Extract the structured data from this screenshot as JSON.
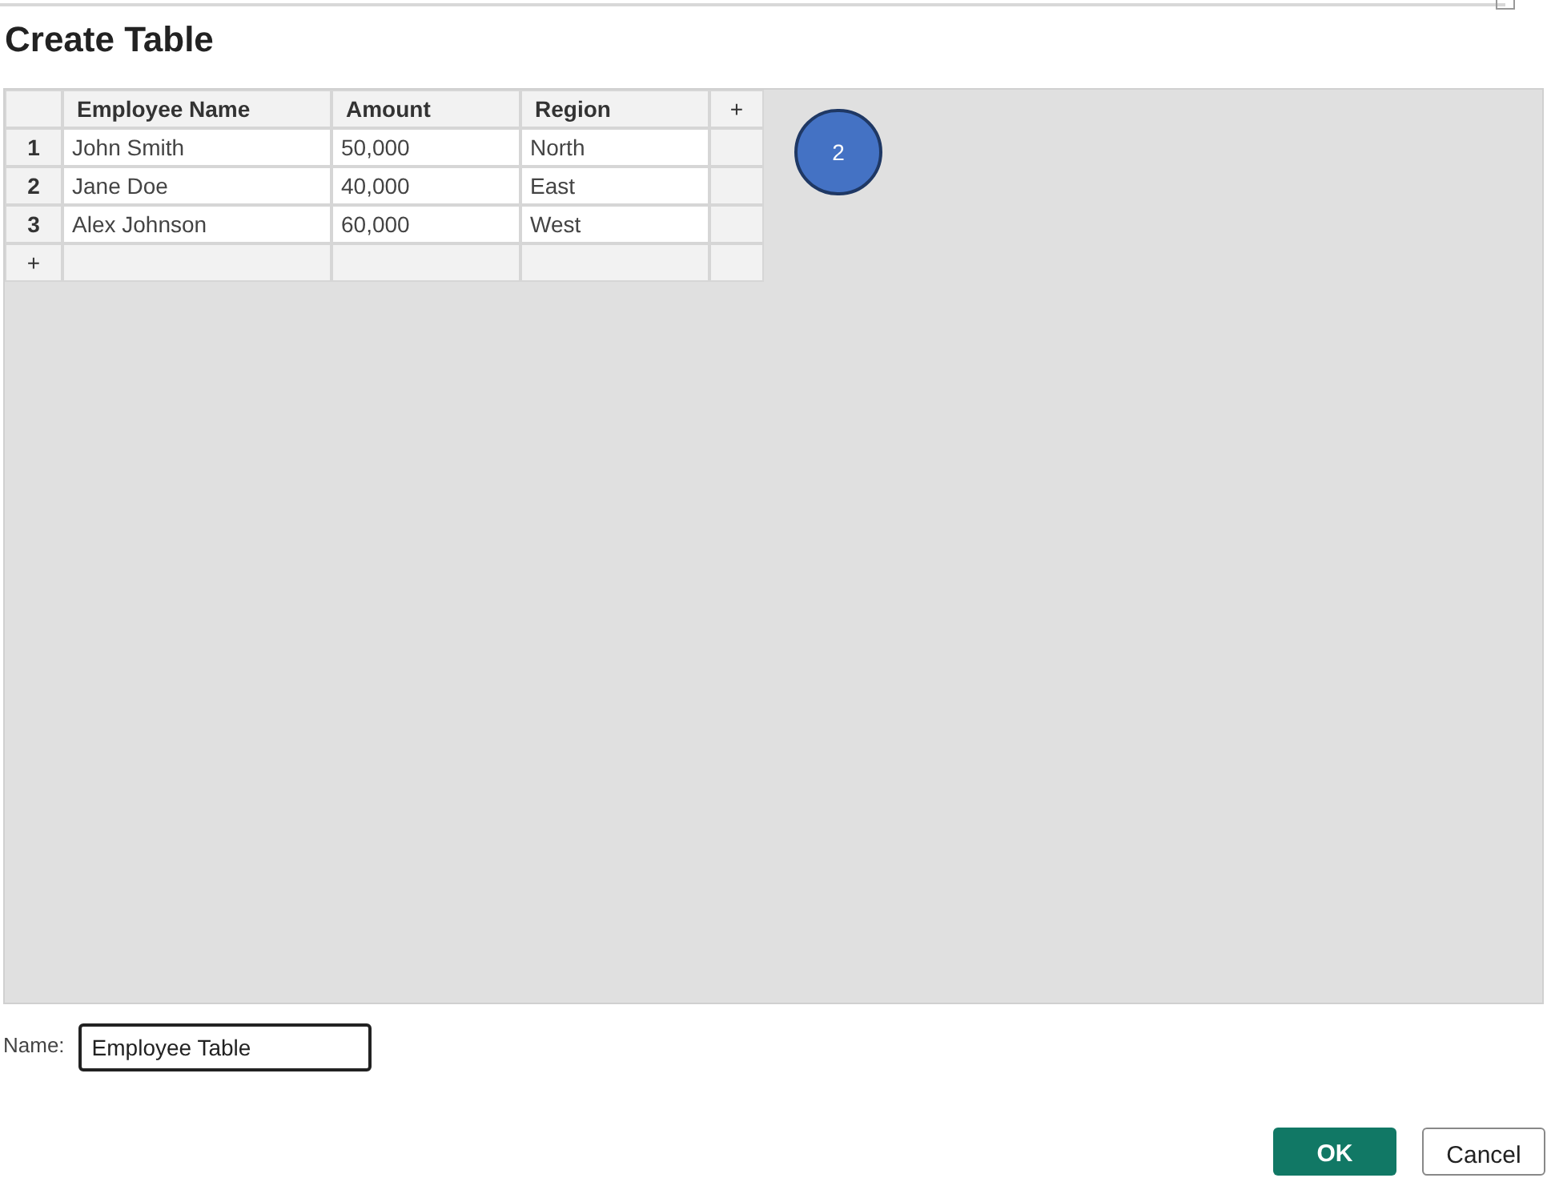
{
  "dialog": {
    "title": "Create Table"
  },
  "table": {
    "add_column": "+",
    "columns": [
      "Employee Name",
      "Amount",
      "Region"
    ],
    "rows": [
      {
        "number": "1",
        "cells": [
          "John Smith",
          "50,000",
          "North"
        ]
      },
      {
        "number": "2",
        "cells": [
          "Jane Doe",
          "40,000",
          "East"
        ]
      },
      {
        "number": "3",
        "cells": [
          "Alex Johnson",
          "60,000",
          "West"
        ]
      }
    ],
    "add_row": "+"
  },
  "step_marker": {
    "label": "2"
  },
  "name_field": {
    "label": "Name:",
    "value": "Employee Table"
  },
  "buttons": [
    {
      "label": "OK",
      "kind": "primary"
    },
    {
      "label": "Cancel",
      "kind": "secondary"
    }
  ]
}
